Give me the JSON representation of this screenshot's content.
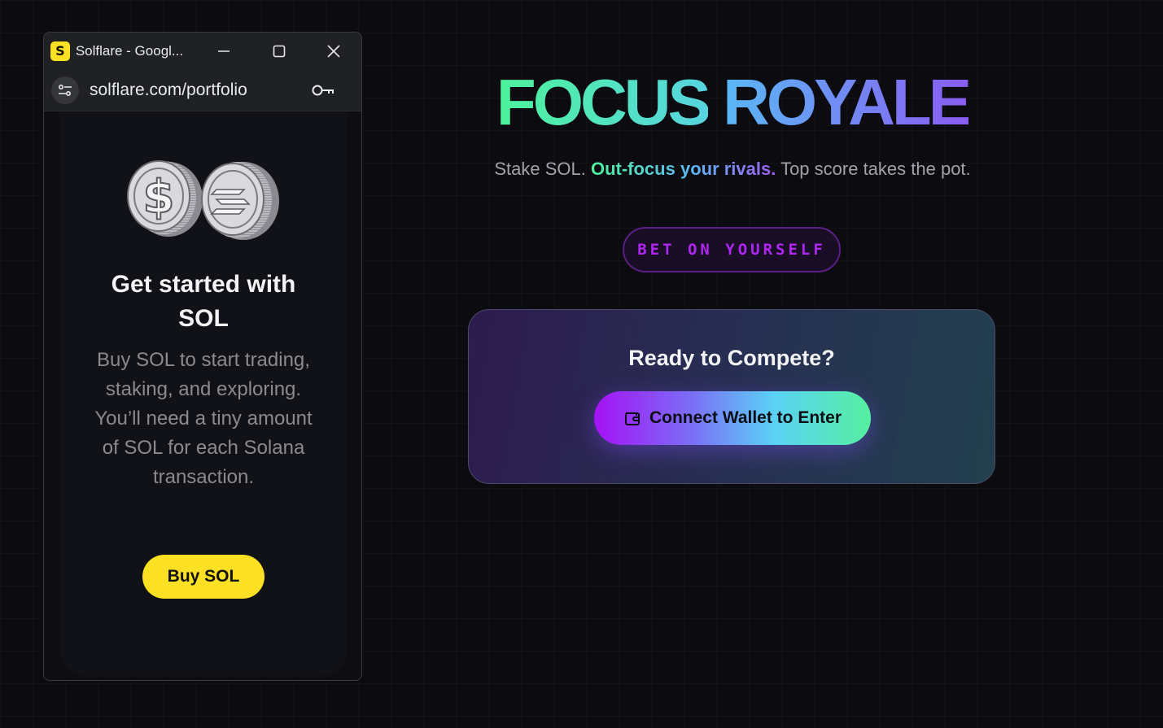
{
  "popup": {
    "window_title": "Solflare - Googl...",
    "url": "solflare.com/portfolio",
    "app_icon_glyph": "S",
    "card": {
      "title": "Get started with SOL",
      "description": "Buy SOL to start trading, staking, and exploring. You’ll need a tiny amount of SOL for each Solana transaction.",
      "buy_button": "Buy SOL"
    }
  },
  "hero": {
    "title_word1": "FOCUS",
    "title_word2": "ROYALE",
    "tagline_start": "Stake SOL. ",
    "tagline_highlight": "Out-focus your rivals.",
    "tagline_end": " Top score takes the pot.",
    "bet_pill": "BET ON YOURSELF"
  },
  "compete": {
    "title": "Ready to Compete?",
    "connect_button": "Connect Wallet to Enter"
  },
  "colors": {
    "background": "#0b0b10",
    "solflare_yellow": "#fce024",
    "accent_green": "#4ef39b",
    "accent_purple": "#b026f2"
  }
}
